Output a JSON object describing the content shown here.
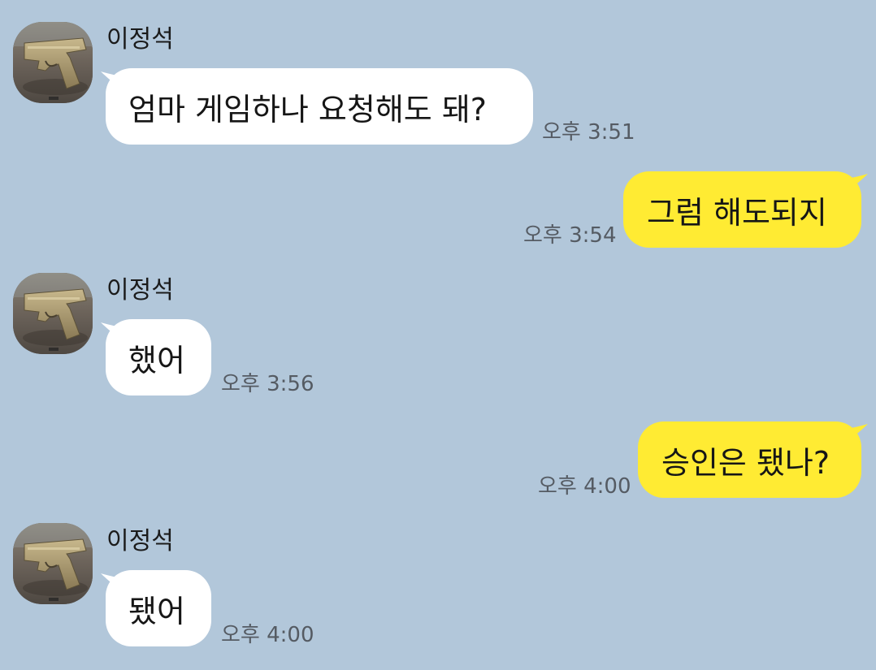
{
  "chat": {
    "messages": [
      {
        "type": "incoming",
        "sender": "이정석",
        "text": "엄마 게임하나 요청해도 돼?",
        "time": "오후 3:51"
      },
      {
        "type": "outgoing",
        "text": "그럼 해도되지",
        "time": "오후 3:54"
      },
      {
        "type": "incoming",
        "sender": "이정석",
        "text": "했어",
        "time": "오후 3:56"
      },
      {
        "type": "outgoing",
        "text": "승인은 됐나?",
        "time": "오후 4:00"
      },
      {
        "type": "incoming",
        "sender": "이정석",
        "text": "됐어",
        "time": "오후 4:00"
      }
    ]
  },
  "colors": {
    "background": "#b2c7da",
    "incoming_bubble": "#ffffff",
    "outgoing_bubble": "#ffeb33"
  },
  "avatar": {
    "icon": "pistol-icon"
  }
}
